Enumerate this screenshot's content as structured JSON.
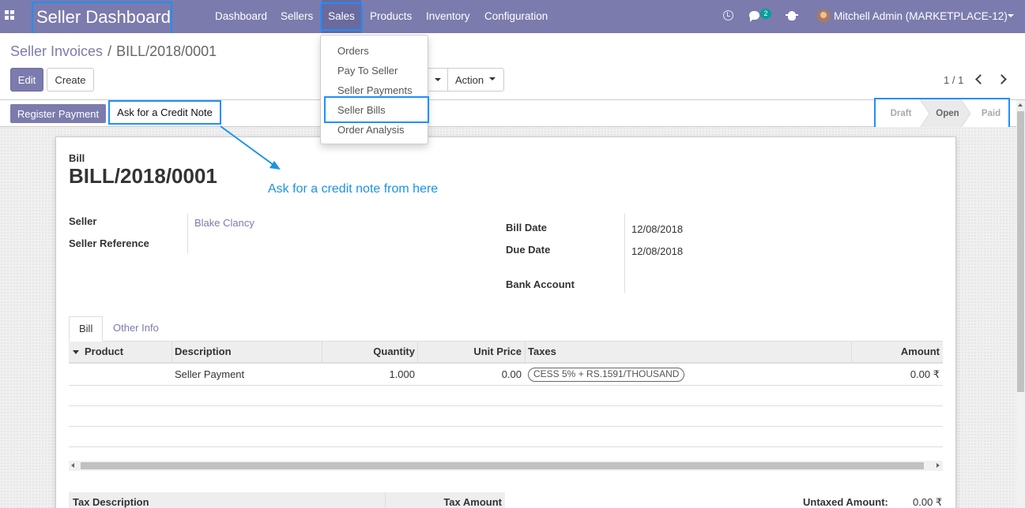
{
  "navbar": {
    "brand": "Seller Dashboard",
    "menu": [
      "Dashboard",
      "Sellers",
      "Sales",
      "Products",
      "Inventory",
      "Configuration"
    ],
    "active_menu": "Sales",
    "chat_count": "2",
    "user": "Mitchell Admin (MARKETPLACE-12)"
  },
  "sales_dropdown": {
    "items": [
      "Orders",
      "Pay To Seller",
      "Seller Payments",
      "Seller Bills",
      "Order Analysis"
    ],
    "highlighted": "Seller Bills"
  },
  "breadcrumb": {
    "parent": "Seller Invoices",
    "separator": "/",
    "current": "BILL/2018/0001"
  },
  "buttons": {
    "edit": "Edit",
    "create": "Create",
    "action": "Action",
    "register_payment": "Register Payment",
    "credit_note": "Ask for a Credit Note"
  },
  "pager": {
    "value": "1 / 1"
  },
  "states": {
    "items": [
      "Draft",
      "Open",
      "Paid"
    ],
    "current": "Open"
  },
  "annotation": "Ask for a credit note from here",
  "document": {
    "type_label": "Bill",
    "number": "BILL/2018/0001",
    "seller_label": "Seller",
    "seller_value": "Blake Clancy",
    "seller_ref_label": "Seller Reference",
    "bill_date_label": "Bill Date",
    "bill_date": "12/08/2018",
    "due_date_label": "Due Date",
    "due_date": "12/08/2018",
    "bank_account_label": "Bank Account"
  },
  "tabs": [
    "Bill",
    "Other Info"
  ],
  "lines": {
    "columns": [
      "Product",
      "Description",
      "Quantity",
      "Unit Price",
      "Taxes",
      "Amount"
    ],
    "rows": [
      {
        "product": "",
        "description": "Seller Payment",
        "quantity": "1.000",
        "unit_price": "0.00",
        "taxes": "CESS 5% + RS.1591/THOUSAND",
        "amount": "0.00 ₹"
      }
    ]
  },
  "tax_table": {
    "columns": [
      "Tax Description",
      "Tax Amount"
    ]
  },
  "totals": {
    "untaxed_label": "Untaxed Amount:",
    "untaxed_value": "0.00 ₹"
  },
  "colors": {
    "brand": "#7c7bad",
    "highlight": "#1e90ff",
    "annotation": "#1a93e6"
  }
}
